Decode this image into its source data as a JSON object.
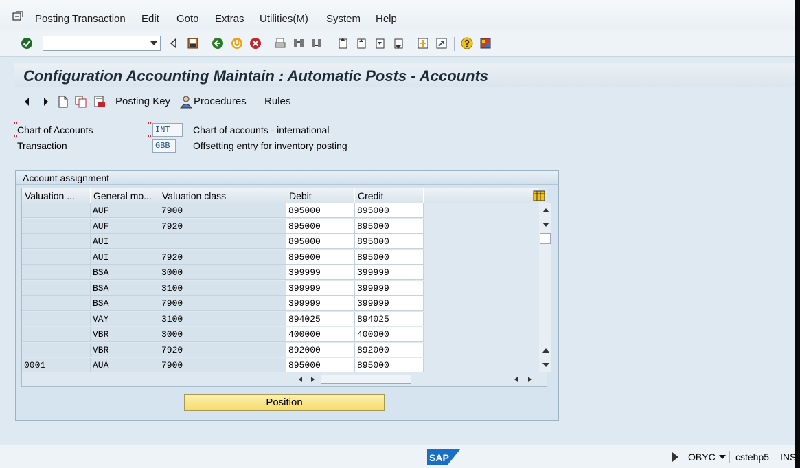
{
  "menu": {
    "items": [
      "Posting Transaction",
      "Edit",
      "Goto",
      "Extras",
      "Utilities(M)",
      "System",
      "Help"
    ]
  },
  "toolbar": {
    "command_value": "",
    "icons": [
      "enter-icon",
      "back-icon",
      "save-icon",
      "back-nav-icon",
      "exit-icon",
      "cancel-icon",
      "print-icon",
      "find-icon",
      "find-next-icon",
      "first-page-icon",
      "prev-page-icon",
      "next-page-icon",
      "last-page-icon",
      "create-session-icon",
      "shortcut-icon",
      "help-icon",
      "layout-icon"
    ]
  },
  "title": "Configuration Accounting Maintain : Automatic Posts - Accounts",
  "app_toolbar": {
    "posting_key": "Posting Key",
    "procedures": "Procedures",
    "rules": "Rules"
  },
  "header": {
    "chart_label": "Chart of Accounts",
    "chart_value": "INT",
    "chart_desc": "Chart of accounts - international",
    "trans_label": "Transaction",
    "trans_value": "GBB",
    "trans_desc": "Offsetting entry for inventory posting"
  },
  "group": {
    "title": "Account assignment",
    "columns": [
      "Valuation ...",
      "General mo...",
      "Valuation class",
      "Debit",
      "Credit"
    ],
    "rows": [
      [
        "",
        "AUF",
        "7900",
        "895000",
        "895000"
      ],
      [
        "",
        "AUF",
        "7920",
        "895000",
        "895000"
      ],
      [
        "",
        "AUI",
        "",
        "895000",
        "895000"
      ],
      [
        "",
        "AUI",
        "7920",
        "895000",
        "895000"
      ],
      [
        "",
        "BSA",
        "3000",
        "399999",
        "399999"
      ],
      [
        "",
        "BSA",
        "3100",
        "399999",
        "399999"
      ],
      [
        "",
        "BSA",
        "7900",
        "399999",
        "399999"
      ],
      [
        "",
        "VAY",
        "3100",
        "894025",
        "894025"
      ],
      [
        "",
        "VBR",
        "3000",
        "400000",
        "400000"
      ],
      [
        "",
        "VBR",
        "7920",
        "892000",
        "892000"
      ],
      [
        "0001",
        "AUA",
        "7900",
        "895000",
        "895000"
      ]
    ],
    "position_button": "Position"
  },
  "status": {
    "logo": "SAP",
    "transaction": "OBYC",
    "server": "cstehp5",
    "mode": "INS"
  },
  "colors": {
    "background": "#dfe9f1",
    "title_text": "#1d2b38",
    "position_button": "#f5dc6e",
    "sap_blue": "#1a6fc4"
  }
}
